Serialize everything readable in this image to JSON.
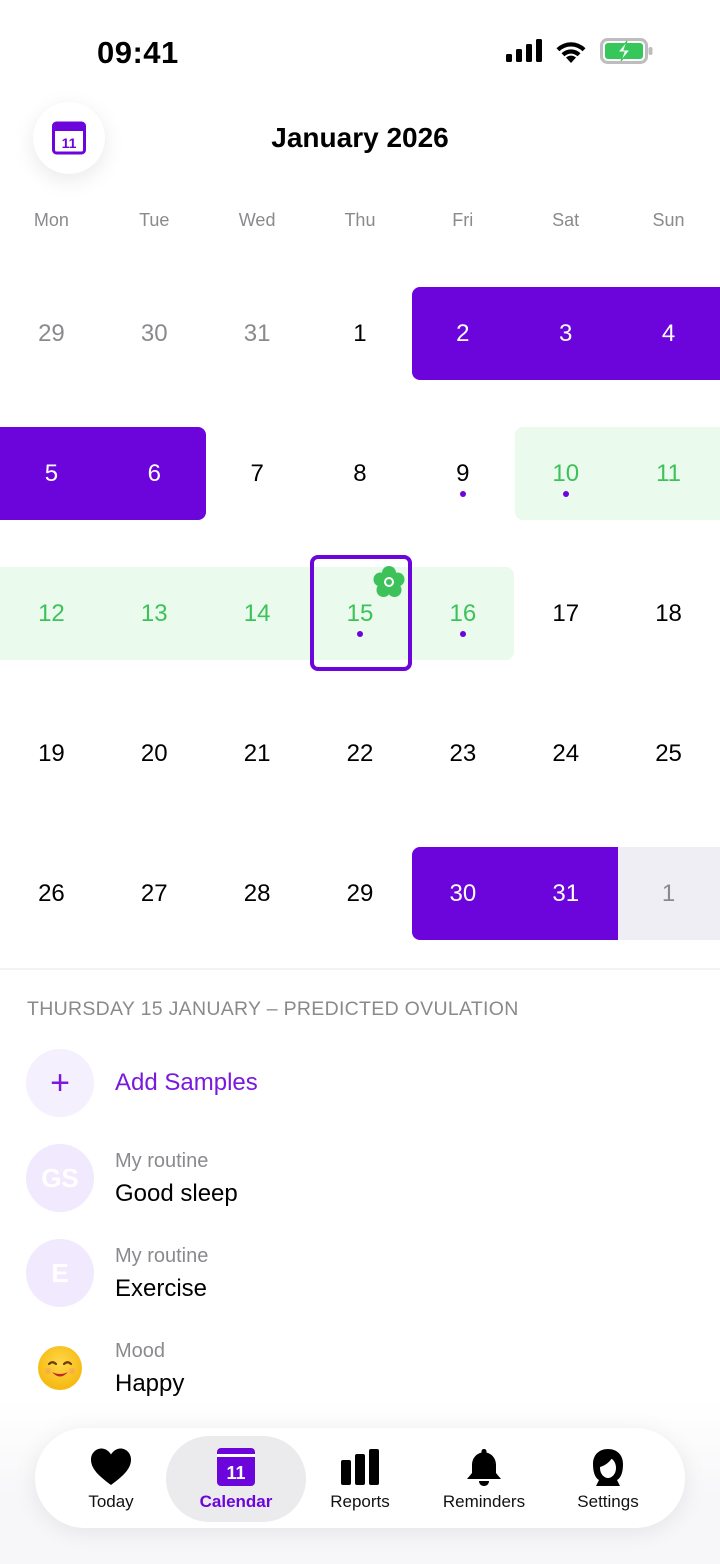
{
  "status_bar": {
    "time": "09:41"
  },
  "header": {
    "calendar_icon_day": "11",
    "title": "January 2026"
  },
  "weekdays": [
    "Mon",
    "Tue",
    "Wed",
    "Thu",
    "Fri",
    "Sat",
    "Sun"
  ],
  "calendar": {
    "weeks": [
      [
        "29",
        "30",
        "31",
        "1",
        "2",
        "3",
        "4"
      ],
      [
        "5",
        "6",
        "7",
        "8",
        "9",
        "10",
        "11"
      ],
      [
        "12",
        "13",
        "14",
        "15",
        "16",
        "17",
        "18"
      ],
      [
        "19",
        "20",
        "21",
        "22",
        "23",
        "24",
        "25"
      ],
      [
        "26",
        "27",
        "28",
        "29",
        "30",
        "31",
        "1"
      ]
    ],
    "selected_day": "15",
    "day_states": {
      "out_of_month": [
        "29",
        "30",
        "31"
      ],
      "period": [
        "2",
        "3",
        "4",
        "5",
        "6",
        "30",
        "31"
      ],
      "fertile": [
        "10",
        "11",
        "12",
        "13",
        "14",
        "15",
        "16"
      ],
      "predicted_ovulation": "15",
      "has_samples": [
        "9",
        "10",
        "15",
        "16"
      ]
    }
  },
  "colors": {
    "accent": "#6c04dc",
    "fertile_bg": "#eafaec",
    "fertile_text": "#3dc25a",
    "muted": "#8a8a8e"
  },
  "details": {
    "section_title": "THURSDAY 15 JANUARY – PREDICTED OVULATION",
    "add_label": "Add Samples",
    "add_icon": "plus-icon",
    "items": [
      {
        "initials": "GS",
        "category": "My routine",
        "value": "Good sleep"
      },
      {
        "initials": "E",
        "category": "My routine",
        "value": "Exercise"
      },
      {
        "icon": "smiling-emoji-icon",
        "category": "Mood",
        "value": "Happy"
      }
    ]
  },
  "tabbar": {
    "active": "Calendar",
    "tabs": [
      {
        "label": "Today",
        "icon": "heart-icon"
      },
      {
        "label": "Calendar",
        "icon": "calendar-icon",
        "icon_text": "11"
      },
      {
        "label": "Reports",
        "icon": "bar-chart-icon"
      },
      {
        "label": "Reminders",
        "icon": "bell-icon"
      },
      {
        "label": "Settings",
        "icon": "profile-icon"
      }
    ]
  }
}
